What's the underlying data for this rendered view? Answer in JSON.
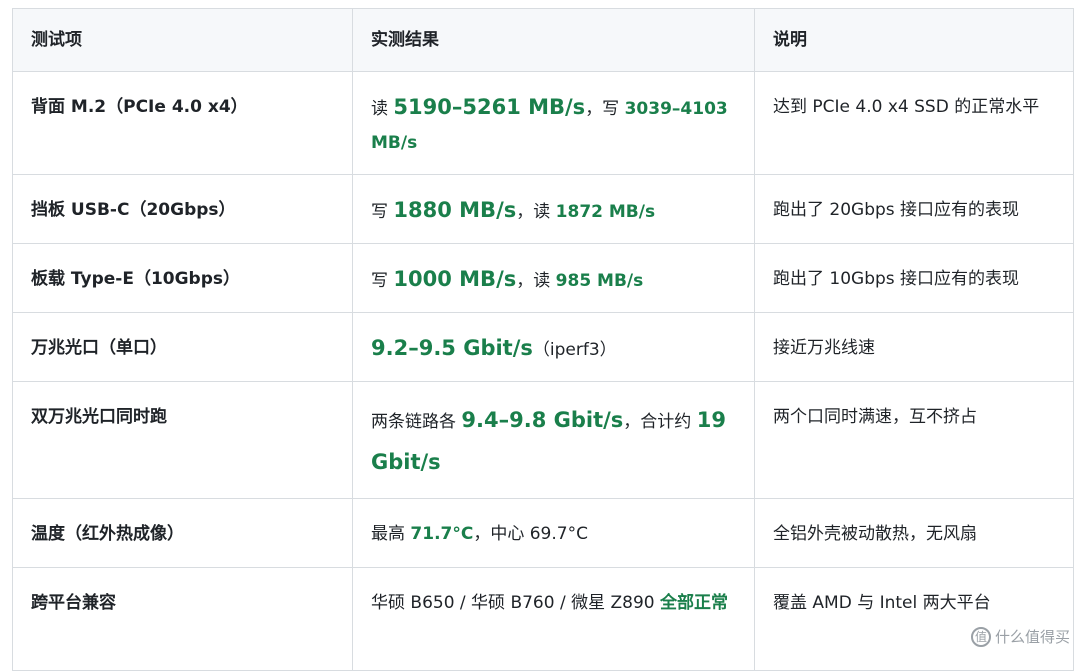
{
  "table": {
    "headers": [
      "测试项",
      "实测结果",
      "说明"
    ],
    "rows": [
      {
        "test": "背面 M.2（PCIe 4.0 x4）",
        "result": {
          "p1": "读 ",
          "v1": "5190–5261 MB/s",
          "p2": "，写 ",
          "v2": "3039–4103 MB/s",
          "p3": ""
        },
        "note": "达到 PCIe 4.0 x4 SSD 的正常水平"
      },
      {
        "test": "挡板 USB-C（20Gbps）",
        "result": {
          "p1": "写 ",
          "v1": "1880 MB/s",
          "p2": "，读 ",
          "v2": "1872 MB/s",
          "p3": ""
        },
        "note": "跑出了 20Gbps 接口应有的表现"
      },
      {
        "test": "板载 Type-E（10Gbps）",
        "result": {
          "p1": "写 ",
          "v1": "1000 MB/s",
          "p2": "，读 ",
          "v2": "985 MB/s",
          "p3": ""
        },
        "note": "跑出了 10Gbps 接口应有的表现"
      },
      {
        "test": "万兆光口（单口）",
        "result": {
          "p1": "",
          "v1": "9.2–9.5 Gbit/s",
          "p2": "（iperf3）",
          "v2": "",
          "p3": ""
        },
        "note": "接近万兆线速"
      },
      {
        "test": "双万兆光口同时跑",
        "result": {
          "p1": "两条链路各 ",
          "v1": "9.4–9.8 Gbit/s",
          "p2": "，合计约 ",
          "v2": "19 Gbit/s",
          "p3": ""
        },
        "note": "两个口同时满速，互不挤占"
      },
      {
        "test": "温度（红外热成像）",
        "result": {
          "p1": "最高 ",
          "v1": "71.7°C",
          "p2": "，中心 69.7°C",
          "v2": "",
          "p3": ""
        },
        "note": "全铝外壳被动散热，无风扇"
      },
      {
        "test": "跨平台兼容",
        "result": {
          "p1": "华硕 B650 / 华硕 B760 / 微星 Z890 ",
          "v1": "全部正常",
          "p2": "",
          "v2": "",
          "p3": ""
        },
        "note": "覆盖 AMD 与 Intel 两大平台"
      }
    ]
  },
  "watermark": {
    "icon": "zhi-icon",
    "text": "什么值得买"
  },
  "colors": {
    "accent_green": "#1a7f4b",
    "header_bg": "#f6f8fa",
    "border": "#d8dce0"
  }
}
